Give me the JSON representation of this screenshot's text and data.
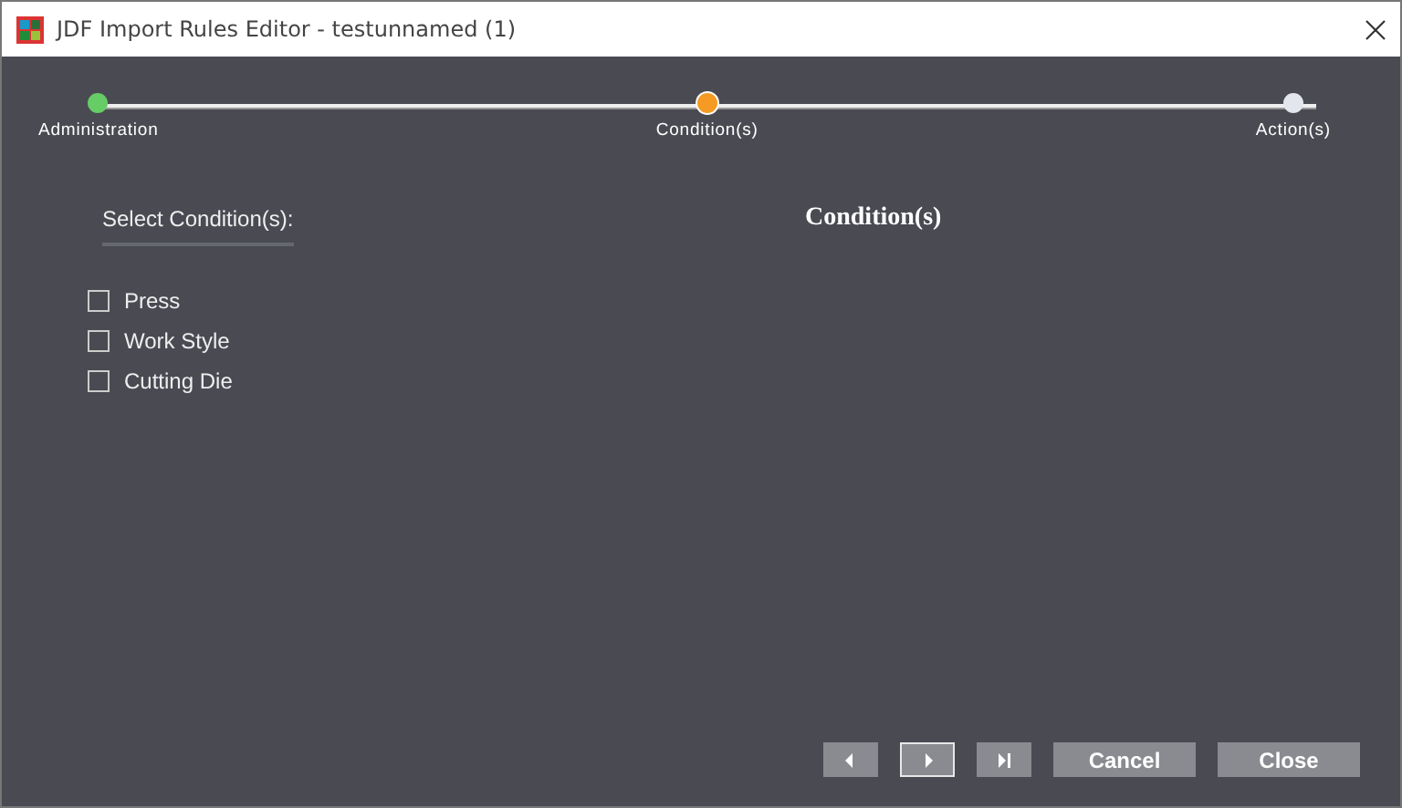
{
  "window": {
    "title": "JDF Import Rules Editor - testunnamed (1)"
  },
  "steps": [
    {
      "label": "Administration",
      "color": "#66cc66",
      "selected": false
    },
    {
      "label": "Condition(s)",
      "color": "#f59a23",
      "selected": true
    },
    {
      "label": "Action(s)",
      "color": "#e4e6ee",
      "selected": false
    }
  ],
  "select_label": "Select Condition(s):",
  "conditions": [
    {
      "label": "Press",
      "checked": false
    },
    {
      "label": "Work Style",
      "checked": false
    },
    {
      "label": "Cutting Die",
      "checked": false
    }
  ],
  "panel_title": "Condition(s)",
  "nav_buttons": [
    {
      "kind": "previous",
      "focused": false
    },
    {
      "kind": "next",
      "focused": true
    },
    {
      "kind": "last",
      "focused": false
    }
  ],
  "buttons": [
    "Cancel",
    "Close"
  ]
}
